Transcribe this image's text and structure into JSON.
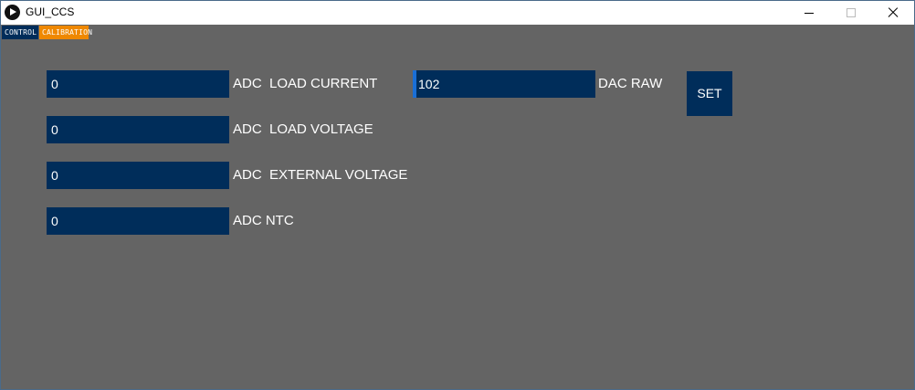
{
  "window": {
    "title": "GUI_CCS"
  },
  "tabs": [
    {
      "label": "CONTROL",
      "color": "#002d5a"
    },
    {
      "label": "CALIBRATION",
      "color": "#ef8800"
    }
  ],
  "fields": [
    {
      "value": "0",
      "label": "ADC  LOAD CURRENT"
    },
    {
      "value": "0",
      "label": "ADC  LOAD VOLTAGE"
    },
    {
      "value": "0",
      "label": "ADC  EXTERNAL VOLTAGE"
    },
    {
      "value": "0",
      "label": "ADC NTC"
    }
  ],
  "dac": {
    "value": "102",
    "label": "DAC RAW",
    "set_label": "SET"
  },
  "colors": {
    "background": "#646464",
    "field": "#002d5a",
    "accent": "#ef8800",
    "focus": "#1a6fd6"
  }
}
